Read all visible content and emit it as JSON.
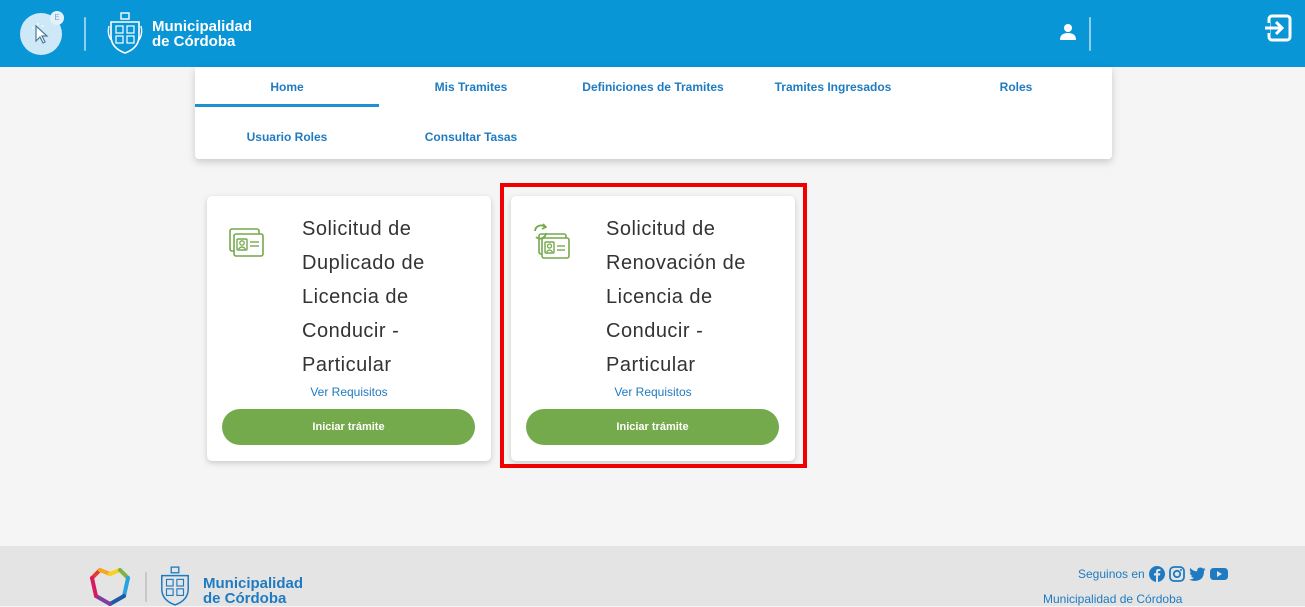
{
  "header": {
    "app_badge": "E",
    "logo_line1": "Municipalidad",
    "logo_line2": "de Córdoba",
    "background": "#0896d7"
  },
  "nav": {
    "tabs": [
      {
        "label": "Home",
        "active": true
      },
      {
        "label": "Mis Tramites"
      },
      {
        "label": "Definiciones de Tramites"
      },
      {
        "label": "Tramites Ingresados"
      },
      {
        "label": "Roles"
      },
      {
        "label": "Usuario Roles"
      },
      {
        "label": "Consultar Tasas"
      }
    ]
  },
  "cards": [
    {
      "title_lines": [
        "Solicitud de",
        "Duplicado de",
        "Licencia de",
        "Conducir -",
        "Particular"
      ],
      "link": "Ver Requisitos",
      "button": "Iniciar trámite",
      "icon": "id-card-icon"
    },
    {
      "title_lines": [
        "Solicitud de",
        "Renovación de",
        "Licencia de",
        "Conducir -",
        "Particular"
      ],
      "link": "Ver Requisitos",
      "button": "Iniciar trámite",
      "icon": "id-card-renew-icon",
      "highlighted": true
    }
  ],
  "footer": {
    "logo_line1": "Municipalidad",
    "logo_line2": "de Córdoba",
    "follow_text": "Seguinos en",
    "org_name": "Municipalidad de Córdoba"
  },
  "colors": {
    "accent": "#1f7bc1",
    "button_green": "#74a94c",
    "highlight_red": "#f00000"
  }
}
